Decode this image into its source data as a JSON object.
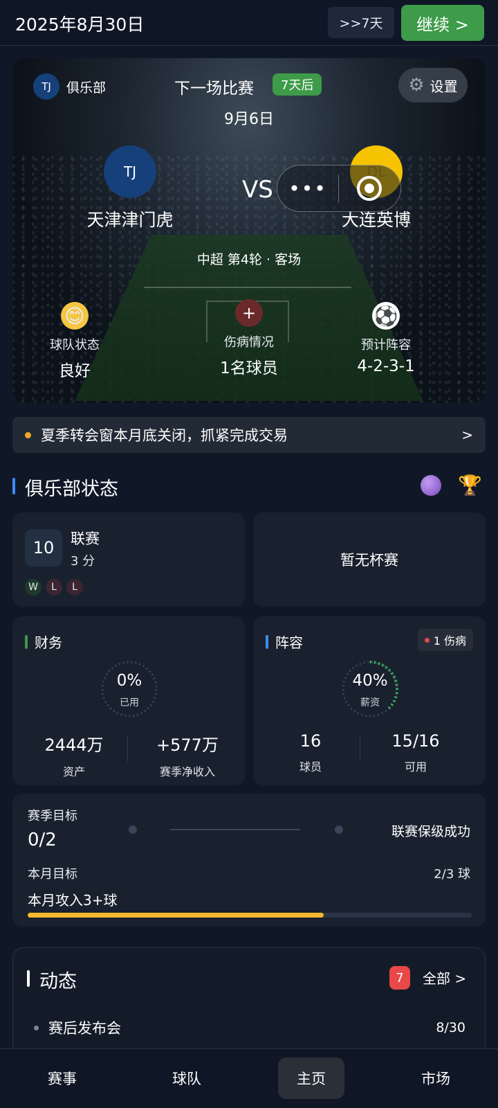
{
  "topbar": {
    "date": "2025年8月30日",
    "skip_label": ">>7天",
    "continue_label": "继续 >"
  },
  "hero": {
    "club_badge": "TJ",
    "club_label": "俱乐部",
    "next_match_title": "下一场比赛",
    "days_until": "7天后",
    "match_date": "9月6日",
    "settings_label": "设置",
    "home_badge": "TJ",
    "home_team": "天津津门虎",
    "away_badge": "DL",
    "away_team": "大连英博",
    "vs": "VS",
    "capsule_dots": "•••",
    "meta": "中超 第4轮 · 客场",
    "stats": [
      {
        "icon": "😊",
        "label": "球队状态",
        "value": "良好"
      },
      {
        "icon": "+",
        "label": "伤病情况",
        "value": "1名球员"
      },
      {
        "icon": "⚽",
        "label": "预计阵容",
        "value": "4-2-3-1"
      }
    ]
  },
  "notice": {
    "text": "夏季转会窗本月底关闭，抓紧完成交易",
    "arrow": ">"
  },
  "club_status": {
    "title": "俱乐部状态"
  },
  "league": {
    "rank": "10",
    "name": "联赛",
    "points": "3 分",
    "form": [
      {
        "r": "W",
        "color": "#1f3a2a"
      },
      {
        "r": "L",
        "color": "#3a2530"
      },
      {
        "r": "L",
        "color": "#3a2530"
      }
    ]
  },
  "cup": {
    "text": "暂无杯赛"
  },
  "finance": {
    "title": "财务",
    "accent": "#3d9b49",
    "ring_pct": "0%",
    "ring_fraction": 0,
    "ring_sub": "已用",
    "assets_value": "2444万",
    "assets_label": "资产",
    "net_value": "+577万",
    "net_label": "赛季净收入"
  },
  "squad": {
    "title": "阵容",
    "accent": "#3b8cf5",
    "injury_badge": "1 伤病",
    "ring_pct": "40%",
    "ring_fraction": 0.4,
    "ring_sub": "薪资",
    "players_value": "16",
    "players_label": "球员",
    "available_value": "15/16",
    "available_label": "可用"
  },
  "goals": {
    "season_label": "赛季目标",
    "season_value": "0/2",
    "season_target": "联赛保级成功",
    "month_label": "本月目标",
    "month_progress": "2/3 球",
    "month_title": "本月攻入3+球",
    "month_fraction": 0.667
  },
  "news": {
    "title": "动态",
    "count": "7",
    "all_label": "全部 >",
    "items": [
      {
        "text": "赛后发布会",
        "date": "8/30"
      }
    ]
  },
  "nav": [
    {
      "label": "赛事"
    },
    {
      "label": "球队"
    },
    {
      "label": "主页",
      "active": true
    },
    {
      "label": "市场"
    }
  ]
}
